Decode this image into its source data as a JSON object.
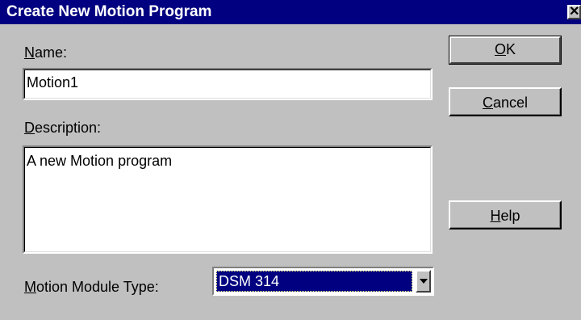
{
  "window": {
    "title": "Create New Motion Program",
    "close_glyph": "✕",
    "icons": {
      "close": "close-icon",
      "dropdown": "chevron-down-icon"
    }
  },
  "name": {
    "label_mnemonic": "N",
    "label_rest": "ame:",
    "value": "Motion1"
  },
  "description": {
    "label_mnemonic": "D",
    "label_rest": "escription:",
    "value": "A new Motion program"
  },
  "module_type": {
    "label_mnemonic": "M",
    "label_rest": "otion Module Type:",
    "selected": "DSM 314"
  },
  "buttons": {
    "ok": {
      "mnemonic": "O",
      "rest": "K"
    },
    "cancel": {
      "mnemonic": "C",
      "rest": "ancel"
    },
    "help": {
      "mnemonic": "H",
      "rest": "elp"
    }
  },
  "colors": {
    "titlebar": "#000080",
    "face": "#c0c0c0",
    "selection": "#000080"
  }
}
